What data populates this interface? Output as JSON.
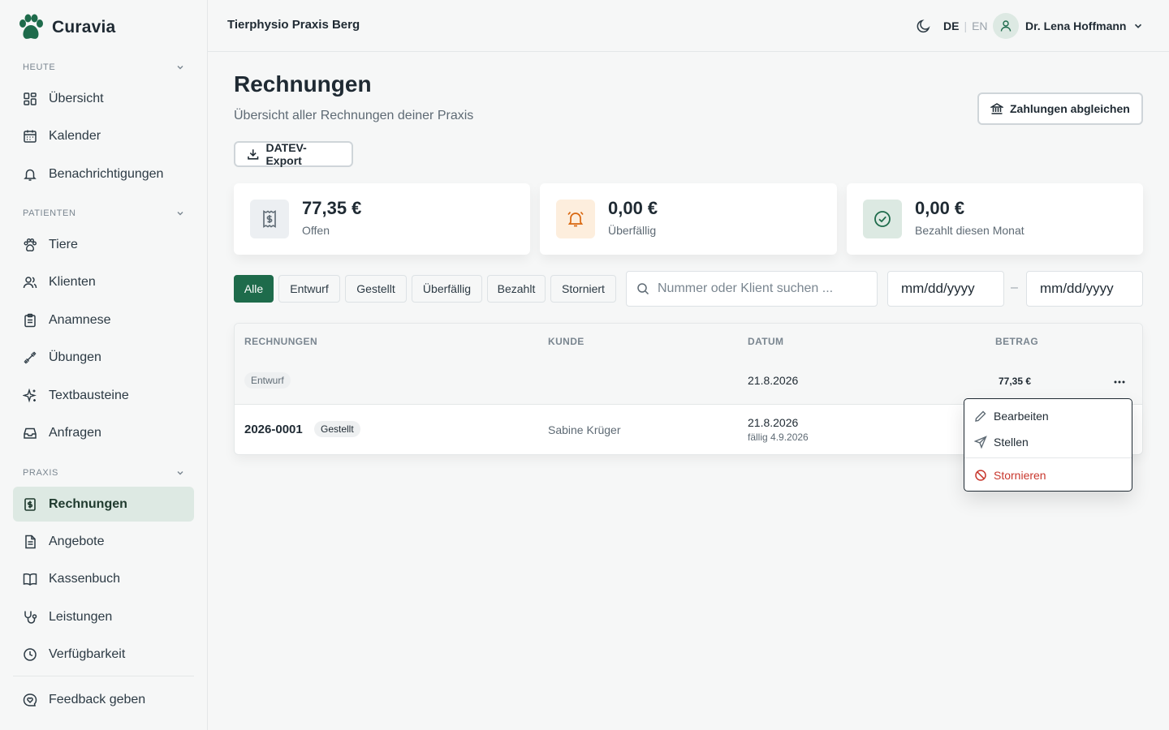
{
  "brand": {
    "name": "Curavia"
  },
  "header": {
    "practice_name": "Tierphysio Praxis Berg",
    "lang_de": "DE",
    "lang_sep": "|",
    "lang_en": "EN",
    "user_name": "Dr. Lena Hoffmann"
  },
  "sidebar": {
    "sections": [
      {
        "label": "HEUTE",
        "items": [
          {
            "label": "Übersicht",
            "icon": "dashboard-icon"
          },
          {
            "label": "Kalender",
            "icon": "calendar-icon"
          },
          {
            "label": "Benachrichtigungen",
            "icon": "bell-icon"
          }
        ]
      },
      {
        "label": "PATIENTEN",
        "items": [
          {
            "label": "Tiere",
            "icon": "paw-icon"
          },
          {
            "label": "Klienten",
            "icon": "users-icon"
          },
          {
            "label": "Anamnese",
            "icon": "clipboard-icon"
          },
          {
            "label": "Übungen",
            "icon": "dumbbell-icon"
          },
          {
            "label": "Textbausteine",
            "icon": "sparkles-icon"
          },
          {
            "label": "Anfragen",
            "icon": "inbox-icon"
          }
        ]
      },
      {
        "label": "PRAXIS",
        "items": [
          {
            "label": "Rechnungen",
            "icon": "receipt-icon",
            "active": true
          },
          {
            "label": "Angebote",
            "icon": "document-icon"
          },
          {
            "label": "Kassenbuch",
            "icon": "book-icon"
          },
          {
            "label": "Leistungen",
            "icon": "stethoscope-icon"
          },
          {
            "label": "Verfügbarkeit",
            "icon": "clock-icon"
          }
        ]
      }
    ],
    "feedback": "Feedback geben"
  },
  "main": {
    "title": "Rechnungen",
    "subtitle": "Übersicht aller Rechnungen deiner Praxis",
    "reconcile_button": "Zahlungen abgleichen",
    "export_button": "DATEV-Export",
    "stats": [
      {
        "value": "77,35 €",
        "label": "Offen",
        "icon": "receipt-icon",
        "bg": "#eceff2",
        "color": "#5e6a74"
      },
      {
        "value": "0,00 €",
        "label": "Überfällig",
        "icon": "alarm-bell-icon",
        "bg": "#fdeedd",
        "color": "#d9670f"
      },
      {
        "value": "0,00 €",
        "label": "Bezahlt diesen Monat",
        "icon": "check-circle-icon",
        "bg": "#dce9e2",
        "color": "#1e6b4b"
      }
    ],
    "filters": [
      "Alle",
      "Entwurf",
      "Gestellt",
      "Überfällig",
      "Bezahlt",
      "Storniert"
    ],
    "active_filter": "Alle",
    "search_placeholder": "Nummer oder Klient suchen ...",
    "date_from_placeholder": "mm/dd/yyyy",
    "date_to_placeholder": "mm/dd/yyyy",
    "date_separator": "–",
    "table": {
      "columns": [
        "RECHNUNGEN",
        "KUNDE",
        "DATUM",
        "BETRAG"
      ],
      "rows": [
        {
          "number": "",
          "status": "Entwurf",
          "client": "",
          "date": "21.8.2026",
          "due": "",
          "amount": "77,35 €"
        },
        {
          "number": "2026-0001",
          "status": "Gestellt",
          "client": "Sabine Krüger",
          "date": "21.8.2026",
          "due": "fällig 4.9.2026",
          "amount": ""
        }
      ]
    },
    "row_menu": {
      "items": [
        {
          "label": "Bearbeiten",
          "icon": "pencil-icon"
        },
        {
          "label": "Stellen",
          "icon": "send-icon"
        },
        {
          "label": "Stornieren",
          "icon": "ban-icon",
          "danger": true
        }
      ]
    }
  },
  "colors": {
    "accent": "#1e6b4b",
    "danger": "#c8372d",
    "text": "#1f2a33",
    "muted": "#5e6a74"
  }
}
